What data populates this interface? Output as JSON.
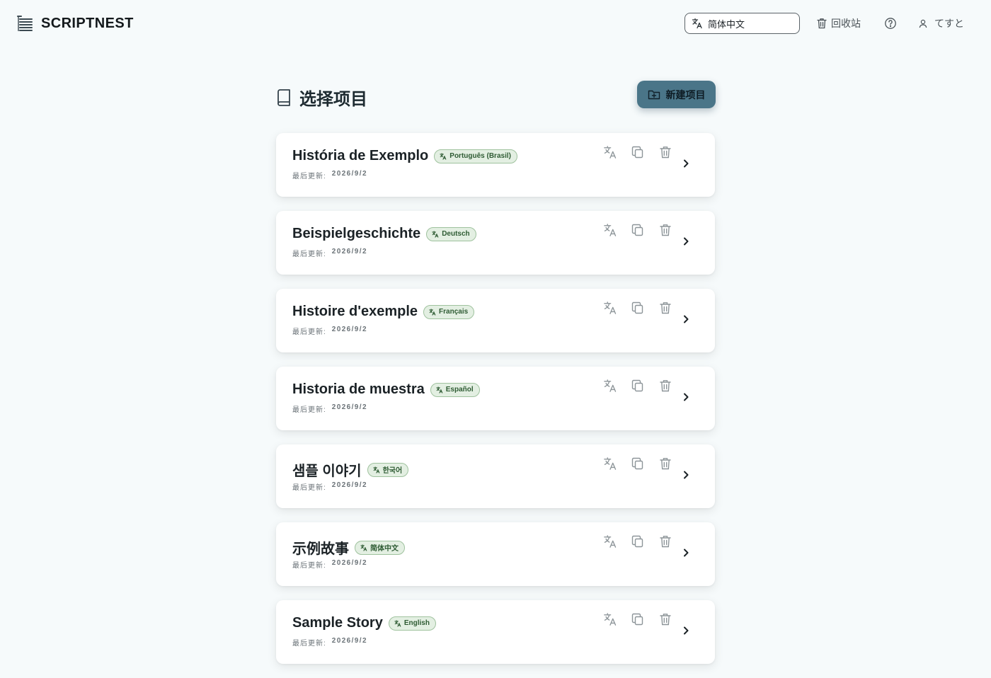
{
  "app": {
    "brand": "SCRIPTNEST"
  },
  "header": {
    "language": "简体中文",
    "trash_label": "回收站",
    "user_name": "てすと"
  },
  "page": {
    "title": "选择项目",
    "new_project_label": "新建项目"
  },
  "colors": {
    "accent": "#4a7588",
    "badge_bg": "#e3efe2",
    "badge_border": "#9fc29e",
    "page_bg": "#f6fafb"
  },
  "projects": [
    {
      "title": "História de Exemplo",
      "language": "Português (Brasil)",
      "updated_label": "最后更新:",
      "updated": "2026/9/2"
    },
    {
      "title": "Beispielgeschichte",
      "language": "Deutsch",
      "updated_label": "最后更新:",
      "updated": "2026/9/2"
    },
    {
      "title": "Histoire d'exemple",
      "language": "Français",
      "updated_label": "最后更新:",
      "updated": "2026/9/2"
    },
    {
      "title": "Historia de muestra",
      "language": "Español",
      "updated_label": "最后更新:",
      "updated": "2026/9/2"
    },
    {
      "title": "샘플 이야기",
      "language": "한국어",
      "updated_label": "最后更新:",
      "updated": "2026/9/2"
    },
    {
      "title": "示例故事",
      "language": "简体中文",
      "updated_label": "最后更新:",
      "updated": "2026/9/2"
    },
    {
      "title": "Sample Story",
      "language": "English",
      "updated_label": "最后更新:",
      "updated": "2026/9/2"
    }
  ]
}
